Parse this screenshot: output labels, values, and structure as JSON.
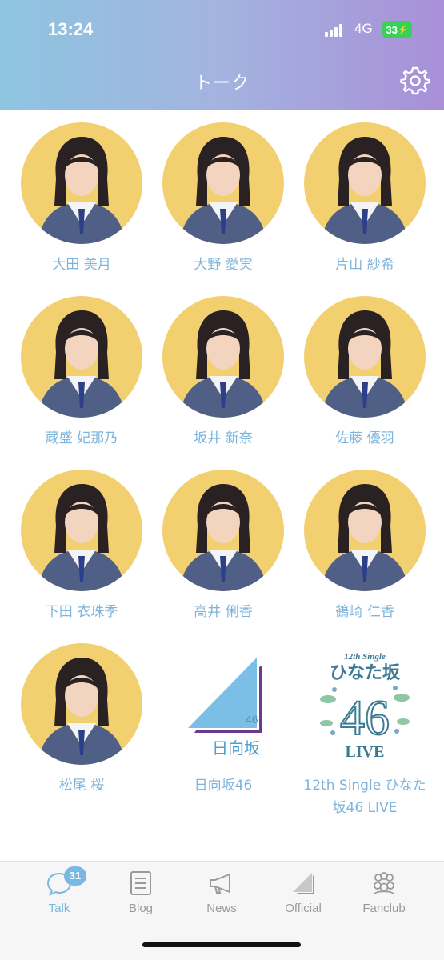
{
  "status": {
    "time": "13:24",
    "network": "4G",
    "battery": "33"
  },
  "header": {
    "title": "トーク"
  },
  "members": [
    {
      "name": "大田 美月"
    },
    {
      "name": "大野 愛実"
    },
    {
      "name": "片山 紗希"
    },
    {
      "name": "蔵盛 妃那乃"
    },
    {
      "name": "坂井 新奈"
    },
    {
      "name": "佐藤 優羽"
    },
    {
      "name": "下田 衣珠季"
    },
    {
      "name": "高井 俐香"
    },
    {
      "name": "鶴崎 仁香"
    },
    {
      "name": "松尾 桜"
    }
  ],
  "groups": [
    {
      "name": "日向坂46",
      "logo_number": "46",
      "logo_text": "日向坂"
    },
    {
      "name": "12th Single ひなた坂46 LIVE",
      "logo_top": "12th Single",
      "logo_title": "ひなた坂",
      "logo_number": "46",
      "logo_bottom": "LIVE"
    }
  ],
  "tabs": [
    {
      "label": "Talk",
      "badge": "31"
    },
    {
      "label": "Blog"
    },
    {
      "label": "News"
    },
    {
      "label": "Official"
    },
    {
      "label": "Fanclub"
    }
  ],
  "colors": {
    "accent": "#79b8e0",
    "avatar_bg": "#f2cf6f",
    "gradient_start": "#8ec5e1",
    "gradient_end": "#a98fd8"
  }
}
